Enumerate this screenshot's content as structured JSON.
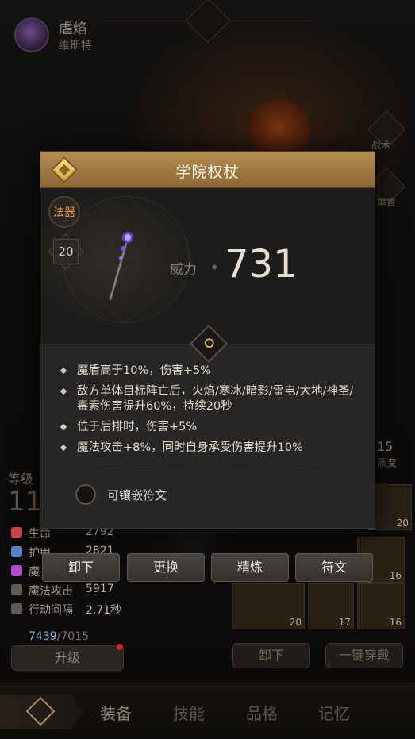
{
  "hero": {
    "name": "虐焰",
    "subtitle": "维斯特"
  },
  "side_buttons": {
    "tactics": "战术",
    "reset": "重置",
    "transform": "质变",
    "transform_num": "15"
  },
  "stats": {
    "level_label": "等级",
    "level_value": "11",
    "rows": [
      {
        "name": "生命",
        "value": "2792",
        "color": "#c9444a"
      },
      {
        "name": "护甲",
        "value": "2821",
        "color": "#5a7fc4"
      },
      {
        "name": "魔",
        "value": "",
        "color": "#b04ad0"
      },
      {
        "name": "魔法攻击",
        "value": "5917",
        "color": "#8a8276"
      },
      {
        "name": "行动间隔",
        "value": "2.71秒",
        "color": "#8a8276"
      }
    ],
    "energy_current": "7439",
    "energy_max": "/7015",
    "upgrade_label": "升级"
  },
  "inventory": {
    "counts": [
      "20",
      "16",
      "20",
      "17",
      "16"
    ],
    "unequip_label": "卸下",
    "one_click_equip_label": "一键穿戴"
  },
  "bottom_nav": {
    "tabs": [
      "装备",
      "技能",
      "品格",
      "记忆"
    ],
    "active": "装备"
  },
  "item": {
    "title": "学院权杖",
    "type": "法器",
    "level": "20",
    "power_label": "威力",
    "power_value": "731",
    "effects": [
      "魔盾高于10%，伤害+5%",
      "敌方单体目标阵亡后，火焰/寒冰/暗影/雷电/大地/神圣/毒素伤害提升60%，持续20秒",
      "位于后排时，伤害+5%",
      "魔法攻击+8%，同时自身承受伤害提升10%"
    ],
    "socket_label": "可镶嵌符文"
  },
  "actions": {
    "unequip": "卸下",
    "replace": "更换",
    "refine": "精炼",
    "rune": "符文"
  },
  "colors": {
    "header": "#a37a44",
    "type_text": "#f0a53a",
    "panel_bg": "#282624"
  }
}
